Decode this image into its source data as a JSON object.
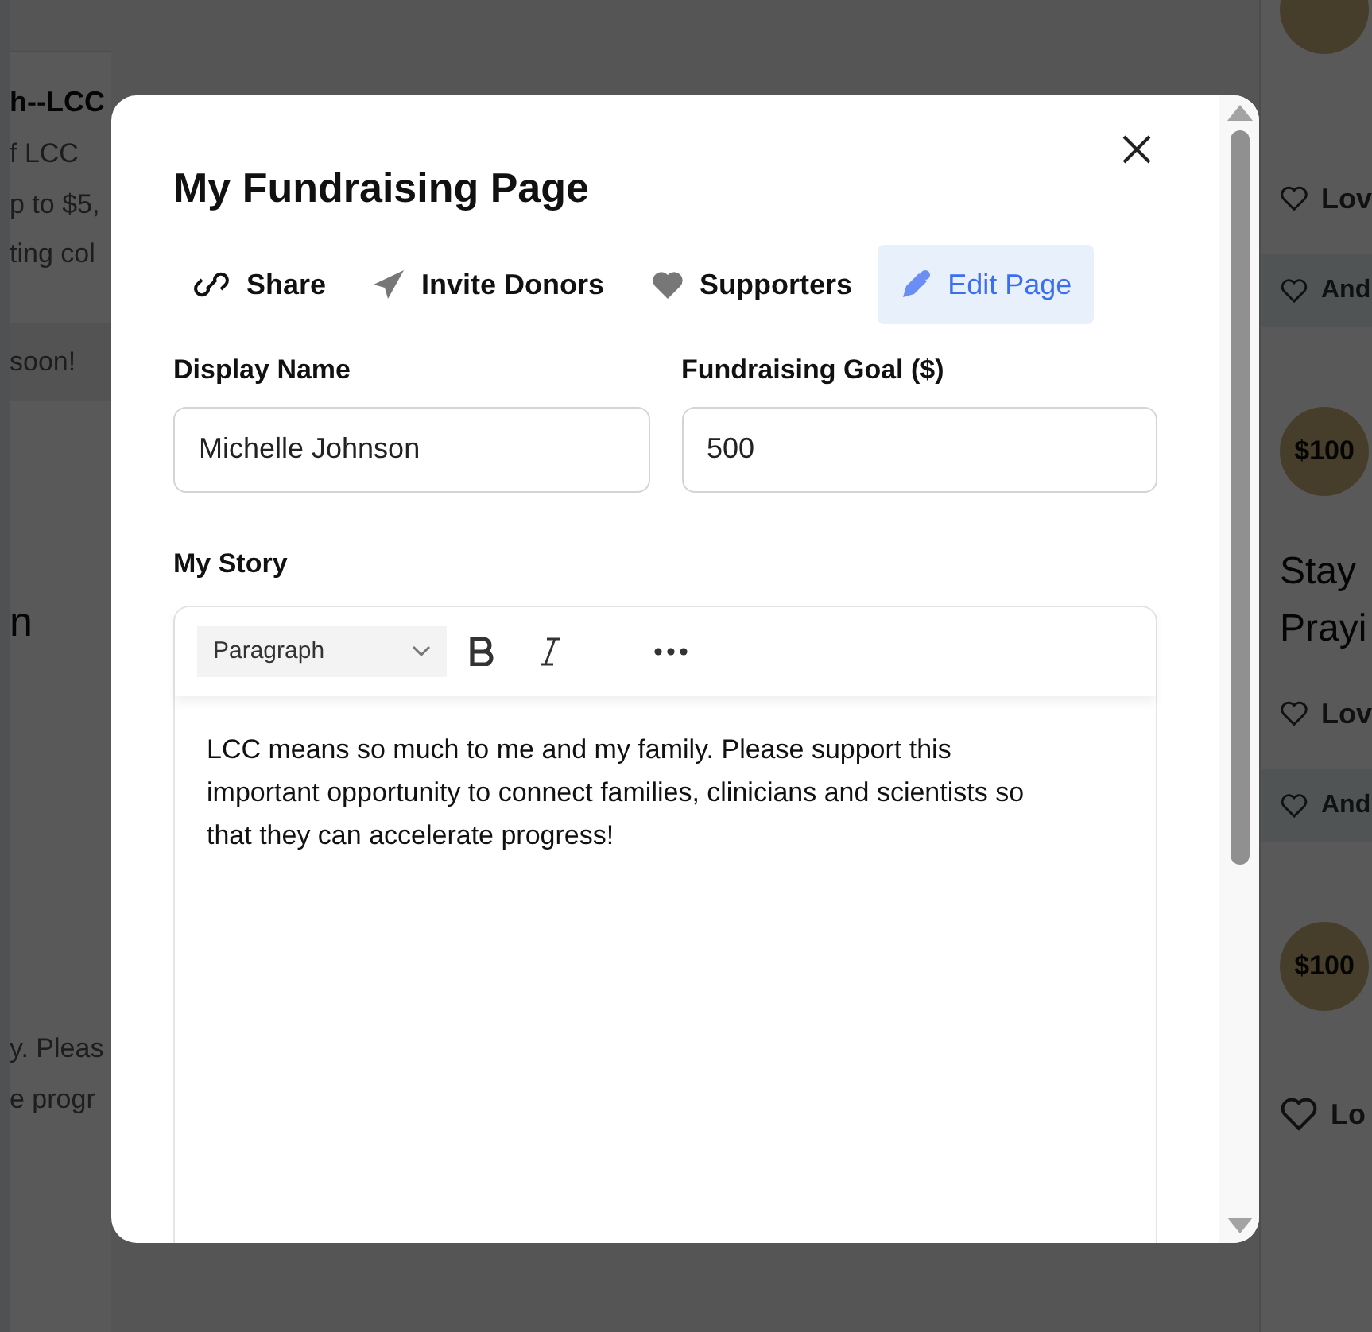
{
  "background": {
    "left": [
      {
        "kind": "title",
        "text": "h--LCC"
      },
      {
        "kind": "text",
        "text": "f LCC"
      },
      {
        "kind": "text",
        "text": "p to $5,"
      },
      {
        "kind": "text",
        "text": "ting col"
      },
      {
        "kind": "banner",
        "text": "soon!"
      },
      {
        "kind": "heading",
        "text": "n"
      },
      {
        "kind": "text",
        "text": "y. Pleas"
      },
      {
        "kind": "text",
        "text": "e progr"
      }
    ],
    "right": [
      {
        "kind": "love",
        "text": "Lov"
      },
      {
        "kind": "another",
        "text": "And"
      },
      {
        "kind": "badge",
        "text": "$100"
      },
      {
        "kind": "heading",
        "text": "Stay"
      },
      {
        "kind": "heading",
        "text": "Prayi"
      },
      {
        "kind": "love",
        "text": "Lov"
      },
      {
        "kind": "another",
        "text": "And"
      },
      {
        "kind": "badge",
        "text": "$100"
      },
      {
        "kind": "love",
        "text": "Lo"
      }
    ]
  },
  "modal": {
    "title": "My Fundraising Page",
    "tabs": [
      {
        "label": "Share",
        "selected": false
      },
      {
        "label": "Invite Donors",
        "selected": false
      },
      {
        "label": "Supporters",
        "selected": false
      },
      {
        "label": "Edit Page",
        "selected": true
      }
    ],
    "fields": [
      {
        "label": "Display Name",
        "value": "Michelle Johnson"
      },
      {
        "label": "Fundraising Goal ($)",
        "value": "500"
      }
    ],
    "story": {
      "label": "My Story",
      "format": "Paragraph",
      "text": "LCC means so much to me and my family. Please support this important opportunity to connect families, clinicians and scientists so that they can accelerate progress!"
    }
  }
}
